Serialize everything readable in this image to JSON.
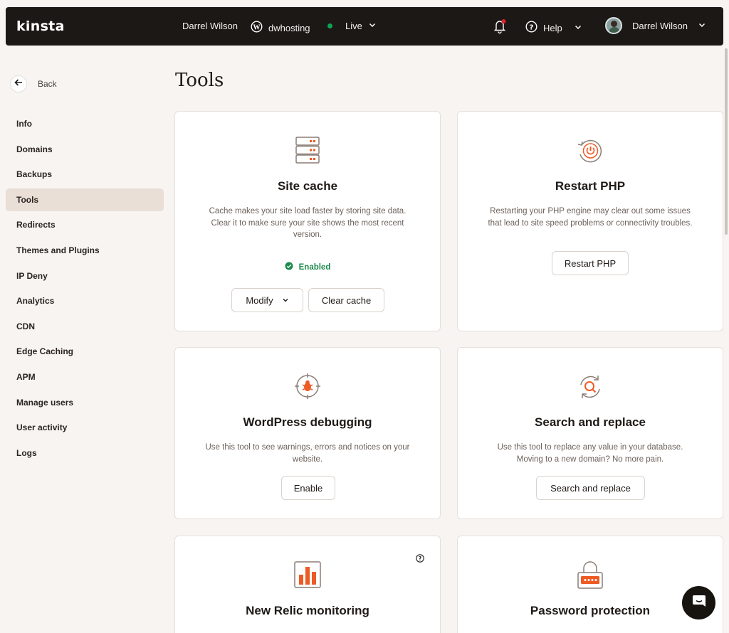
{
  "topbar": {
    "logo": "kinsta",
    "user_name": "Darrel Wilson",
    "site_name": "dwhosting",
    "environment": "Live",
    "help_label": "Help",
    "account_name": "Darrel Wilson",
    "notification_dot_color": "#e01e2b"
  },
  "sidebar": {
    "back_label": "Back",
    "items": [
      {
        "label": "Info"
      },
      {
        "label": "Domains"
      },
      {
        "label": "Backups"
      },
      {
        "label": "Tools",
        "active": true
      },
      {
        "label": "Redirects"
      },
      {
        "label": "Themes and Plugins"
      },
      {
        "label": "IP Deny"
      },
      {
        "label": "Analytics"
      },
      {
        "label": "CDN"
      },
      {
        "label": "Edge Caching"
      },
      {
        "label": "APM"
      },
      {
        "label": "Manage users"
      },
      {
        "label": "User activity"
      },
      {
        "label": "Logs"
      }
    ]
  },
  "main": {
    "title": "Tools",
    "cards": {
      "site_cache": {
        "title": "Site cache",
        "description": "Cache makes your site load faster by storing site data. Clear it to make sure your site shows the most recent version.",
        "status": "Enabled",
        "modify_label": "Modify",
        "clear_label": "Clear cache"
      },
      "restart_php": {
        "title": "Restart PHP",
        "description": "Restarting your PHP engine may clear out some issues that lead to site speed problems or connectivity troubles.",
        "button_label": "Restart PHP"
      },
      "wp_debugging": {
        "title": "WordPress debugging",
        "description": "Use this tool to see warnings, errors and notices on your website.",
        "button_label": "Enable"
      },
      "search_replace": {
        "title": "Search and replace",
        "description": "Use this tool to replace any value in your database. Moving to a new domain? No more pain.",
        "button_label": "Search and replace"
      },
      "new_relic": {
        "title": "New Relic monitoring"
      },
      "password_protection": {
        "title": "Password protection"
      }
    }
  },
  "colors": {
    "accent": "#ee5a24",
    "background": "#f7f4f1",
    "topbar": "#1c1816",
    "active_nav": "#eadfd7",
    "status_green": "#1d8a4c"
  }
}
